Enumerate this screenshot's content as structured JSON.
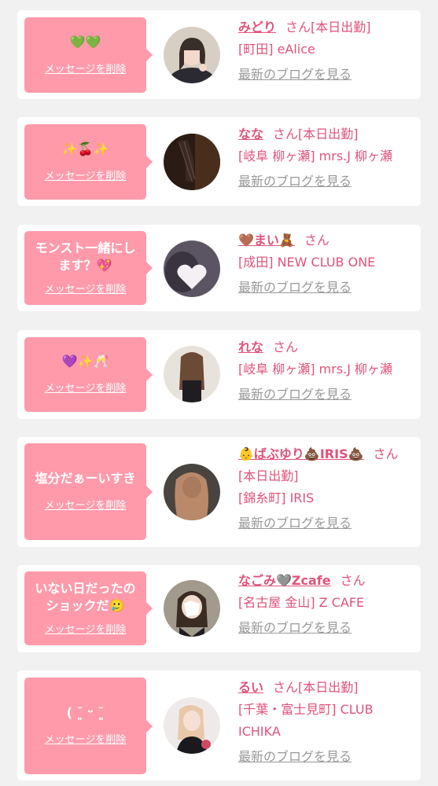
{
  "delete_label": "メッセージを削除",
  "san": "さん",
  "blog_label": "最新のブログを見る",
  "colors": {
    "accent": "#e0537a",
    "bubble": "#ff9aab",
    "background": "#f1f1f1"
  },
  "items": [
    {
      "message": "💚💚",
      "name": "みどり",
      "status": "[本日出勤]",
      "shop": "[町田] eAlice",
      "avatar_icon": "girl-photo-avatar"
    },
    {
      "message": "✨🍒✨",
      "name": "なな",
      "status": "[本日出勤]",
      "shop": "[岐阜 柳ヶ瀬] mrs.J 柳ヶ瀬",
      "avatar_icon": "girl-photo-avatar"
    },
    {
      "message": "モンスト一緒にし\nます？💖",
      "name": "🤎まい🧸",
      "status": "",
      "shop": "[成田] NEW CLUB ONE",
      "avatar_icon": "secret-heart-avatar"
    },
    {
      "message": "💜✨🥂",
      "name": "れな",
      "status": "",
      "shop": "[岐阜 柳ヶ瀬] mrs.J 柳ヶ瀬",
      "avatar_icon": "girl-photo-avatar"
    },
    {
      "message": "塩分だぁーいすき",
      "name": "👶ばぶゆり💩IRIS💩",
      "status": "[本日出勤]",
      "shop": "[錦糸町] IRIS",
      "avatar_icon": "girl-photo-avatar"
    },
    {
      "message": "いない日だったの\nショックだ🥲",
      "name": "なごみ🩶Zcafe",
      "status": "",
      "shop": "[名古屋 金山] Z CAFE",
      "avatar_icon": "girl-photo-avatar"
    },
    {
      "message": "( ˘͈ ᵕ ˘͈",
      "name": "るい",
      "status": "[本日出勤]",
      "shop": "[千葉・富士見町] CLUB ICHIKA",
      "avatar_icon": "girl-photo-avatar"
    }
  ]
}
